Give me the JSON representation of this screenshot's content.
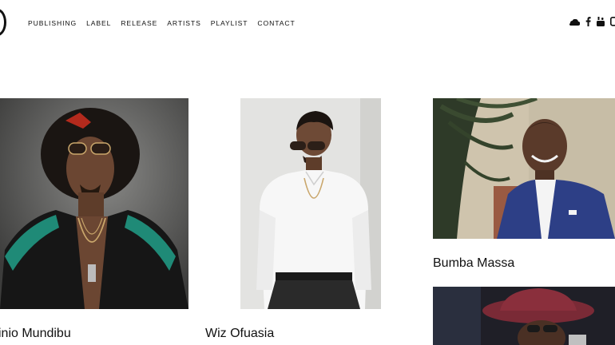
{
  "nav": {
    "items": [
      "PUBLISHING",
      "LABEL",
      "RELEASE",
      "ARTISTS",
      "PLAYLIST",
      "CONTACT"
    ]
  },
  "social": {
    "icons": [
      "soundcloud-icon",
      "facebook-icon",
      "youtube-icon",
      "instagram-icon"
    ]
  },
  "artists": [
    {
      "name": "Innocent Junior Mundibu",
      "display": "inio Mundibu"
    },
    {
      "name": "Wiz Ofuasia"
    },
    {
      "name": "Bumba Massa"
    }
  ],
  "colors": {
    "text": "#111111",
    "background": "#ffffff"
  }
}
